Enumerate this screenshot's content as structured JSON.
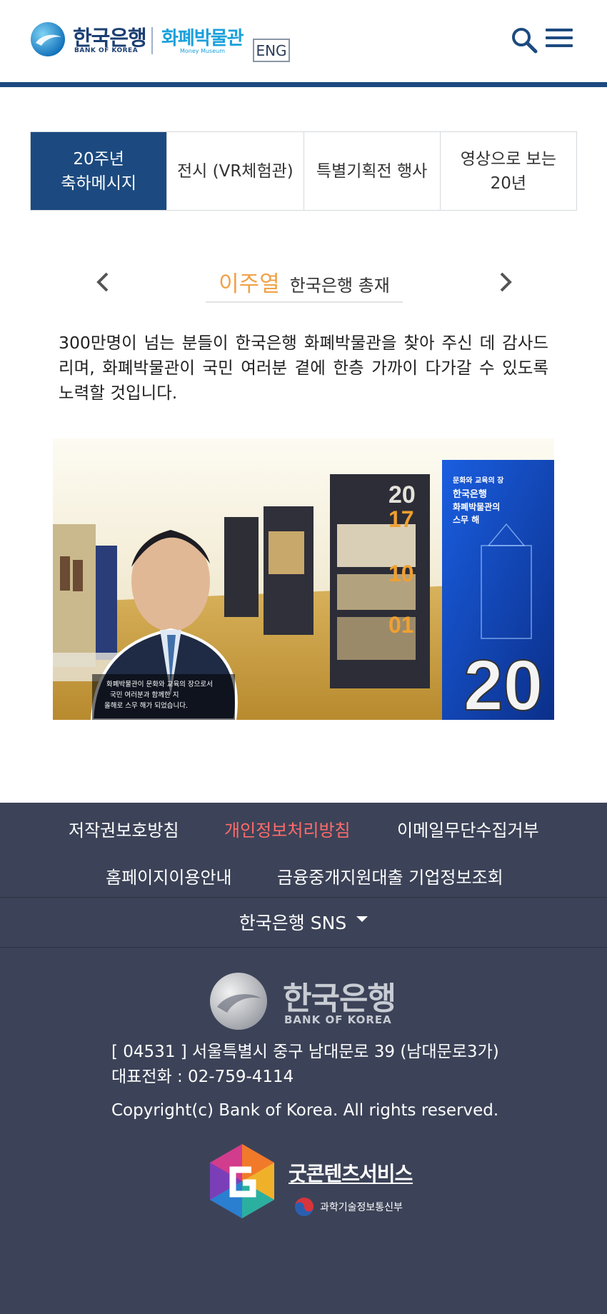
{
  "header": {
    "logo_ko": "한국은행",
    "logo_en": "BANK OF KOREA",
    "museum_ko": "화폐박물관",
    "museum_en": "Money Museum",
    "lang_button": "ENG",
    "search_icon": "search-icon",
    "menu_icon": "hamburger-menu-icon",
    "accent_color": "#1c4a80"
  },
  "tabs": [
    {
      "label": "20주년\n축하메시지",
      "active": true
    },
    {
      "label": "전시 (VR체험관)",
      "active": false
    },
    {
      "label": "특별기획전 행사",
      "active": false
    },
    {
      "label": "영상으로 보는\n20년",
      "active": false
    }
  ],
  "slider": {
    "prev_icon": "chevron-left-icon",
    "next_icon": "chevron-right-icon",
    "speaker_name": "이주열",
    "speaker_title": "한국은행 총재",
    "message": "300만명이 넘는 분들이 한국은행 화폐박물관을 찾아 주신 데 감사드리며, 화폐박물관이 국민 여러분 곁에 한층 가까이 다가갈 수 있도록 노력할 것입니다.",
    "photo_caption": "화폐박물관이 문화와 교육의 장으로서 국민 여러분과 함께한 지 올해로 스무 해가 되었습니다.",
    "panel_title": "문화와 교육의 장 한국은행 화폐박물관의 스무 해",
    "panel_years": "2017 2010 2001"
  },
  "footer": {
    "links_row1": [
      "저작권보호방침",
      "개인정보처리방침",
      "이메일무단수집거부"
    ],
    "links_row2": [
      "홈페이지이용안내",
      "금융중개지원대출 기업정보조회"
    ],
    "highlight_color": "#ff6b6b",
    "sns_label": "한국은행 SNS",
    "logo_ko": "한국은행",
    "logo_en": "BANK OF KOREA",
    "address": "[ 04531 ] 서울특별시 중구 남대문로 39 (남대문로3가)",
    "phone": "대표전화 : 02-759-4114",
    "copyright": "Copyright(c) Bank of Korea. All rights reserved.",
    "good_content_title": "굿콘텐츠서비스",
    "good_content_sub": "과학기술정보통신부",
    "bg_color": "#3c4358"
  }
}
